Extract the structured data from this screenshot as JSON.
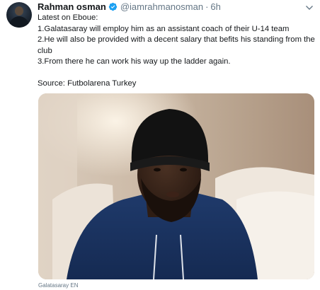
{
  "author": {
    "name": "Rahman osman",
    "handle": "@iamrahmanosman",
    "separator": "·",
    "time": "6h",
    "verified": true
  },
  "tweet": {
    "lines": [
      "Latest on Eboue:",
      "1.Galatasaray will employ him as an assistant coach of their U-14 team",
      "2.He will also be provided with a decent salary that befits his standing from the",
      "club",
      "3.From there he can work his way up the ladder again.",
      "Source: Futbolarena Turkey"
    ]
  },
  "media": {
    "credit": "Galatasaray EN"
  },
  "icons": {
    "verified": "verified-badge-icon",
    "more": "chevron-down-icon"
  },
  "colors": {
    "text": "#14171a",
    "secondary": "#657786",
    "verified": "#1da1f2"
  }
}
